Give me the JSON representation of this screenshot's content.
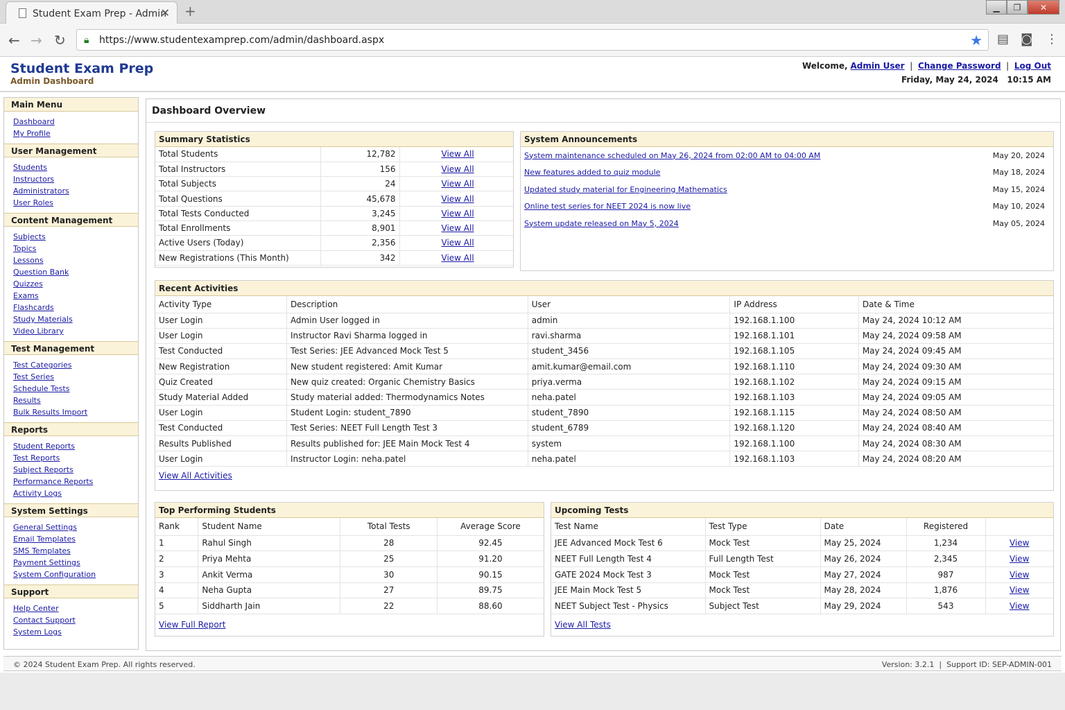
{
  "browser": {
    "tab_title": "Student Exam Prep - Admin",
    "url": "https://www.studentexamprep.com/admin/dashboard.aspx"
  },
  "header": {
    "title": "Student Exam Prep",
    "subtitle": "Admin Dashboard",
    "welcome": "Welcome,",
    "user": "Admin User",
    "change_password": "Change Password",
    "logout": "Log Out",
    "datetime": "Friday, May 24, 2024   10:15 AM"
  },
  "sidebar": [
    {
      "title": "Main Menu",
      "items": [
        "Dashboard",
        "My Profile"
      ]
    },
    {
      "title": "User Management",
      "items": [
        "Students",
        "Instructors",
        "Administrators",
        "User Roles"
      ]
    },
    {
      "title": "Content Management",
      "items": [
        "Subjects",
        "Topics",
        "Lessons",
        "Question Bank",
        "Quizzes",
        "Exams",
        "Flashcards",
        "Study Materials",
        "Video Library"
      ]
    },
    {
      "title": "Test Management",
      "items": [
        "Test Categories",
        "Test Series",
        "Schedule Tests",
        "Results",
        "Bulk Results Import"
      ]
    },
    {
      "title": "Reports",
      "items": [
        "Student Reports",
        "Test Reports",
        "Subject Reports",
        "Performance Reports",
        "Activity Logs"
      ]
    },
    {
      "title": "System Settings",
      "items": [
        "General Settings",
        "Email Templates",
        "SMS Templates",
        "Payment Settings",
        "System Configuration"
      ]
    },
    {
      "title": "Support",
      "items": [
        "Help Center",
        "Contact Support",
        "System Logs"
      ]
    }
  ],
  "main": {
    "title": "Dashboard Overview",
    "summary": {
      "title": "Summary Statistics",
      "link_label": "View All",
      "rows": [
        [
          "Total Students",
          "12,782"
        ],
        [
          "Total Instructors",
          "156"
        ],
        [
          "Total Subjects",
          "24"
        ],
        [
          "Total Questions",
          "45,678"
        ],
        [
          "Total Tests Conducted",
          "3,245"
        ],
        [
          "Total Enrollments",
          "8,901"
        ],
        [
          "Active Users (Today)",
          "2,356"
        ],
        [
          "New Registrations (This Month)",
          "342"
        ]
      ]
    },
    "announcements": {
      "title": "System Announcements",
      "rows": [
        [
          "System maintenance scheduled on May 26, 2024 from 02:00 AM to 04:00 AM",
          "May 20, 2024"
        ],
        [
          "New features added to quiz module",
          "May 18, 2024"
        ],
        [
          "Updated study material for Engineering Mathematics",
          "May 15, 2024"
        ],
        [
          "Online test series for NEET 2024 is now live",
          "May 10, 2024"
        ],
        [
          "System update released on May 5, 2024",
          "May 05, 2024"
        ]
      ]
    },
    "activities": {
      "title": "Recent Activities",
      "columns": [
        "Activity Type",
        "Description",
        "User",
        "IP Address",
        "Date & Time"
      ],
      "rows": [
        [
          "User Login",
          "Admin User logged in",
          "admin",
          "192.168.1.100",
          "May 24, 2024 10:12 AM"
        ],
        [
          "User Login",
          "Instructor Ravi Sharma logged in",
          "ravi.sharma",
          "192.168.1.101",
          "May 24, 2024 09:58 AM"
        ],
        [
          "Test Conducted",
          "Test Series: JEE Advanced Mock Test 5",
          "student_3456",
          "192.168.1.105",
          "May 24, 2024 09:45 AM"
        ],
        [
          "New Registration",
          "New student registered: Amit Kumar",
          "amit.kumar@email.com",
          "192.168.1.110",
          "May 24, 2024 09:30 AM"
        ],
        [
          "Quiz Created",
          "New quiz created: Organic Chemistry Basics",
          "priya.verma",
          "192.168.1.102",
          "May 24, 2024 09:15 AM"
        ],
        [
          "Study Material Added",
          "Study material added: Thermodynamics Notes",
          "neha.patel",
          "192.168.1.103",
          "May 24, 2024 09:05 AM"
        ],
        [
          "User Login",
          "Student Login: student_7890",
          "student_7890",
          "192.168.1.115",
          "May 24, 2024 08:50 AM"
        ],
        [
          "Test Conducted",
          "Test Series: NEET Full Length Test 3",
          "student_6789",
          "192.168.1.120",
          "May 24, 2024 08:40 AM"
        ],
        [
          "Results Published",
          "Results published for: JEE Main Mock Test 4",
          "system",
          "192.168.1.100",
          "May 24, 2024 08:30 AM"
        ],
        [
          "User Login",
          "Instructor Login: neha.patel",
          "neha.patel",
          "192.168.1.103",
          "May 24, 2024 08:20 AM"
        ]
      ],
      "footer_link": "View All Activities"
    },
    "top_students": {
      "title": "Top Performing Students",
      "columns": [
        "Rank",
        "Student Name",
        "Total Tests",
        "Average Score"
      ],
      "rows": [
        [
          "1",
          "Rahul Singh",
          "28",
          "92.45"
        ],
        [
          "2",
          "Priya Mehta",
          "25",
          "91.20"
        ],
        [
          "3",
          "Ankit Verma",
          "30",
          "90.15"
        ],
        [
          "4",
          "Neha Gupta",
          "27",
          "89.75"
        ],
        [
          "5",
          "Siddharth Jain",
          "22",
          "88.60"
        ]
      ],
      "footer_link": "View Full Report"
    },
    "upcoming": {
      "title": "Upcoming Tests",
      "columns": [
        "Test Name",
        "Test Type",
        "Date",
        "Registered",
        ""
      ],
      "link_label": "View",
      "rows": [
        [
          "JEE Advanced Mock Test 6",
          "Mock Test",
          "May 25, 2024",
          "1,234"
        ],
        [
          "NEET Full Length Test 4",
          "Full Length Test",
          "May 26, 2024",
          "2,345"
        ],
        [
          "GATE 2024 Mock Test 3",
          "Mock Test",
          "May 27, 2024",
          "987"
        ],
        [
          "JEE Main Mock Test 5",
          "Mock Test",
          "May 28, 2024",
          "1,876"
        ],
        [
          "NEET Subject Test - Physics",
          "Subject Test",
          "May 29, 2024",
          "543"
        ]
      ],
      "footer_link": "View All Tests"
    }
  },
  "footer": {
    "copyright": "© 2024 Student Exam Prep. All rights reserved.",
    "version": "Version: 3.2.1  |  Support ID: SEP-ADMIN-001"
  }
}
